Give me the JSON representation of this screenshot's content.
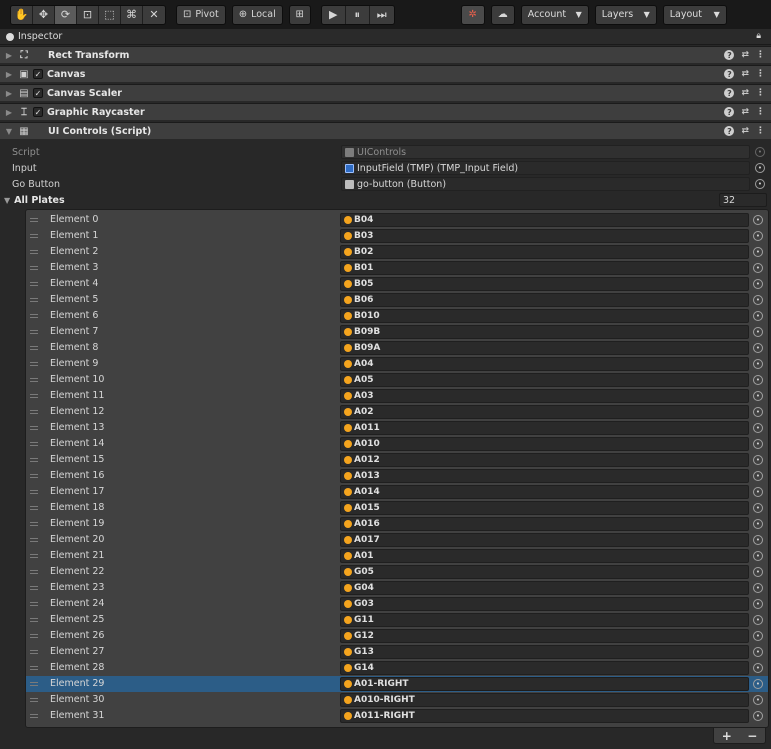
{
  "toolbar": {
    "tools": [
      {
        "icon": "hand-icon",
        "glyph": "✋"
      },
      {
        "icon": "move-icon",
        "glyph": "✥"
      },
      {
        "icon": "rotate-icon",
        "glyph": "⟳"
      },
      {
        "icon": "scale-icon",
        "glyph": "⊡"
      },
      {
        "icon": "rect-tool-icon",
        "glyph": "⬚"
      },
      {
        "icon": "transform-icon",
        "glyph": "⌘"
      },
      {
        "icon": "custom-tool-icon",
        "glyph": "✕"
      }
    ],
    "pivot_label": "Pivot",
    "local_label": "Local",
    "play_buttons": [
      {
        "icon": "play-icon",
        "glyph": "▶"
      },
      {
        "icon": "pause-icon",
        "glyph": "⏸"
      },
      {
        "icon": "step-icon",
        "glyph": "⏭"
      }
    ],
    "account_label": "Account",
    "layers_label": "Layers",
    "layout_label": "Layout"
  },
  "inspector": {
    "tab_title": "Inspector"
  },
  "components": [
    {
      "name": "Rect Transform",
      "has_check": false,
      "expanded": false
    },
    {
      "name": "Canvas",
      "has_check": true,
      "expanded": false
    },
    {
      "name": "Canvas Scaler",
      "has_check": true,
      "expanded": false
    },
    {
      "name": "Graphic Raycaster",
      "has_check": true,
      "expanded": false
    },
    {
      "name": "UI Controls (Script)",
      "has_check": false,
      "expanded": true
    }
  ],
  "properties": {
    "script_label": "Script",
    "script_value": "UIControls",
    "input_label": "Input",
    "input_value": "InputField (TMP) (TMP_Input Field)",
    "go_button_label": "Go Button",
    "go_button_value": "go-button (Button)"
  },
  "all_plates": {
    "label": "All Plates",
    "count": "32",
    "selected_index": 29,
    "elements": [
      {
        "label": "Element 0",
        "value": "B04"
      },
      {
        "label": "Element 1",
        "value": "B03"
      },
      {
        "label": "Element 2",
        "value": "B02"
      },
      {
        "label": "Element 3",
        "value": "B01"
      },
      {
        "label": "Element 4",
        "value": "B05"
      },
      {
        "label": "Element 5",
        "value": "B06"
      },
      {
        "label": "Element 6",
        "value": "B010"
      },
      {
        "label": "Element 7",
        "value": "B09B"
      },
      {
        "label": "Element 8",
        "value": "B09A"
      },
      {
        "label": "Element 9",
        "value": "A04"
      },
      {
        "label": "Element 10",
        "value": "A05"
      },
      {
        "label": "Element 11",
        "value": "A03"
      },
      {
        "label": "Element 12",
        "value": "A02"
      },
      {
        "label": "Element 13",
        "value": "A011"
      },
      {
        "label": "Element 14",
        "value": "A010"
      },
      {
        "label": "Element 15",
        "value": "A012"
      },
      {
        "label": "Element 16",
        "value": "A013"
      },
      {
        "label": "Element 17",
        "value": "A014"
      },
      {
        "label": "Element 18",
        "value": "A015"
      },
      {
        "label": "Element 19",
        "value": "A016"
      },
      {
        "label": "Element 20",
        "value": "A017"
      },
      {
        "label": "Element 21",
        "value": "A01"
      },
      {
        "label": "Element 22",
        "value": "G05"
      },
      {
        "label": "Element 23",
        "value": "G04"
      },
      {
        "label": "Element 24",
        "value": "G03"
      },
      {
        "label": "Element 25",
        "value": "G11"
      },
      {
        "label": "Element 26",
        "value": "G12"
      },
      {
        "label": "Element 27",
        "value": "G13"
      },
      {
        "label": "Element 28",
        "value": "G14"
      },
      {
        "label": "Element 29",
        "value": "A01-RIGHT"
      },
      {
        "label": "Element 30",
        "value": "A010-RIGHT"
      },
      {
        "label": "Element 31",
        "value": "A011-RIGHT"
      }
    ],
    "add_label": "+",
    "remove_label": "−"
  },
  "colors": {
    "background": "#282828",
    "selection": "#2c5d87",
    "prefab_icon": "#f4a41e"
  }
}
